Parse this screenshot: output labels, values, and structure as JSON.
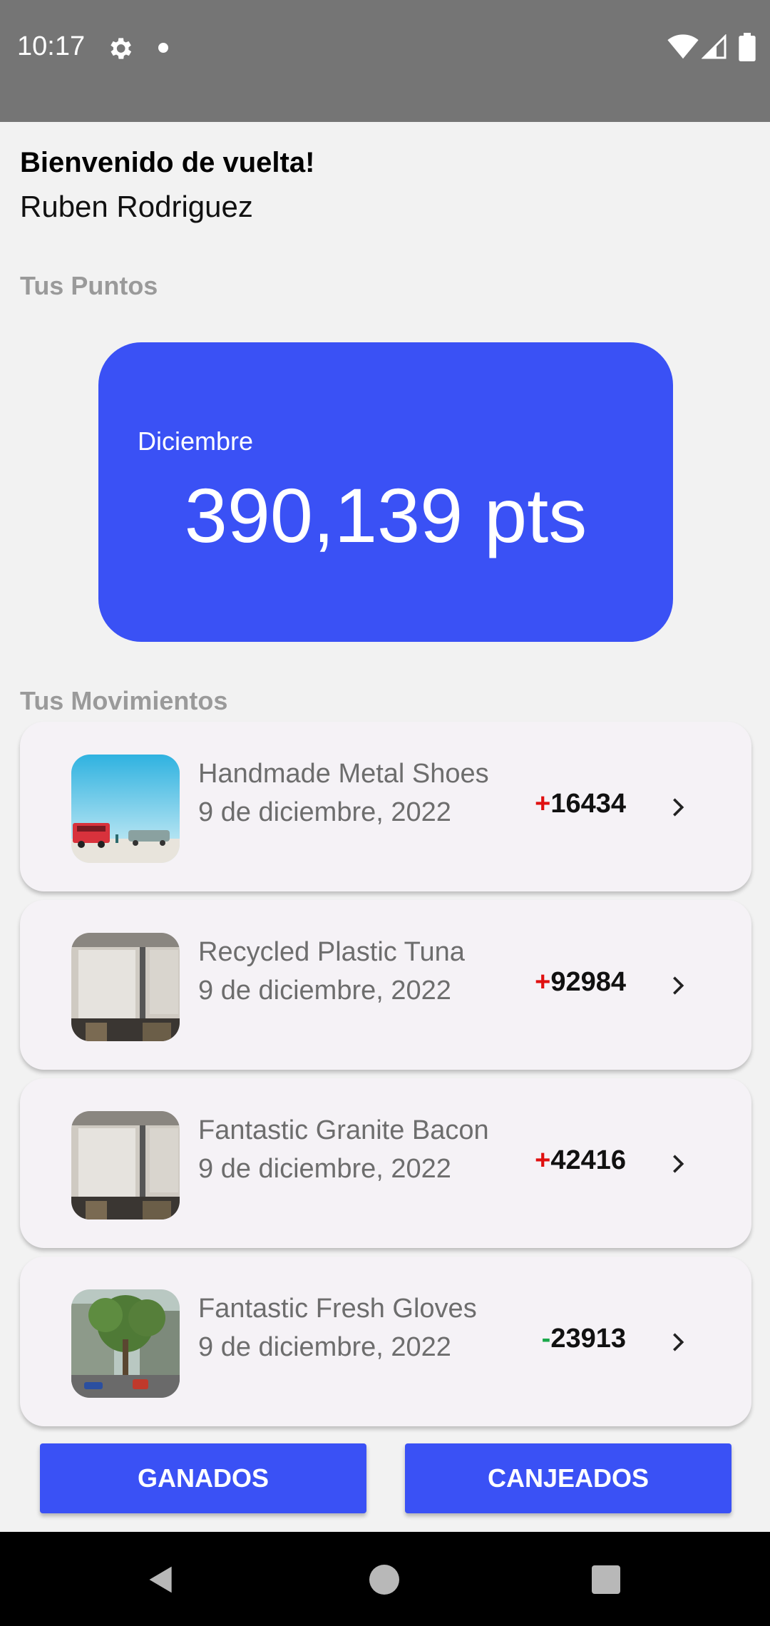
{
  "status_bar": {
    "time": "10:17",
    "icons": [
      "gear-icon",
      "notification-dot-icon",
      "wifi-icon",
      "signal-icon",
      "battery-icon"
    ]
  },
  "header": {
    "welcome": "Bienvenido de vuelta!",
    "user_name": "Ruben Rodriguez"
  },
  "points": {
    "section_title": "Tus Puntos",
    "month": "Diciembre",
    "value": "390,139 pts",
    "card_color": "#3a51f5"
  },
  "movements": {
    "section_title": "Tus Movimientos",
    "items": [
      {
        "title": "Handmade Metal Shoes",
        "date": "9 de diciembre, 2022",
        "sign": "+",
        "amount": "16434",
        "sign_color": "#e01010",
        "thumbnail": "beach-vehicles-photo"
      },
      {
        "title": "Recycled Plastic Tuna",
        "date": "9 de diciembre, 2022",
        "sign": "+",
        "amount": "92984",
        "sign_color": "#e01010",
        "thumbnail": "building-facade-photo"
      },
      {
        "title": "Fantastic Granite Bacon",
        "date": "9 de diciembre, 2022",
        "sign": "+",
        "amount": "42416",
        "sign_color": "#e01010",
        "thumbnail": "building-facade-photo"
      },
      {
        "title": "Fantastic Fresh Gloves",
        "date": "9 de diciembre, 2022",
        "sign": "-",
        "amount": "23913",
        "sign_color": "#1aa84a",
        "thumbnail": "street-tree-photo"
      }
    ]
  },
  "actions": {
    "earned_label": "GANADOS",
    "redeemed_label": "CANJEADOS"
  },
  "colors": {
    "accent": "#3a51f5",
    "status_bar": "#757575",
    "background": "#f2f2f2"
  }
}
